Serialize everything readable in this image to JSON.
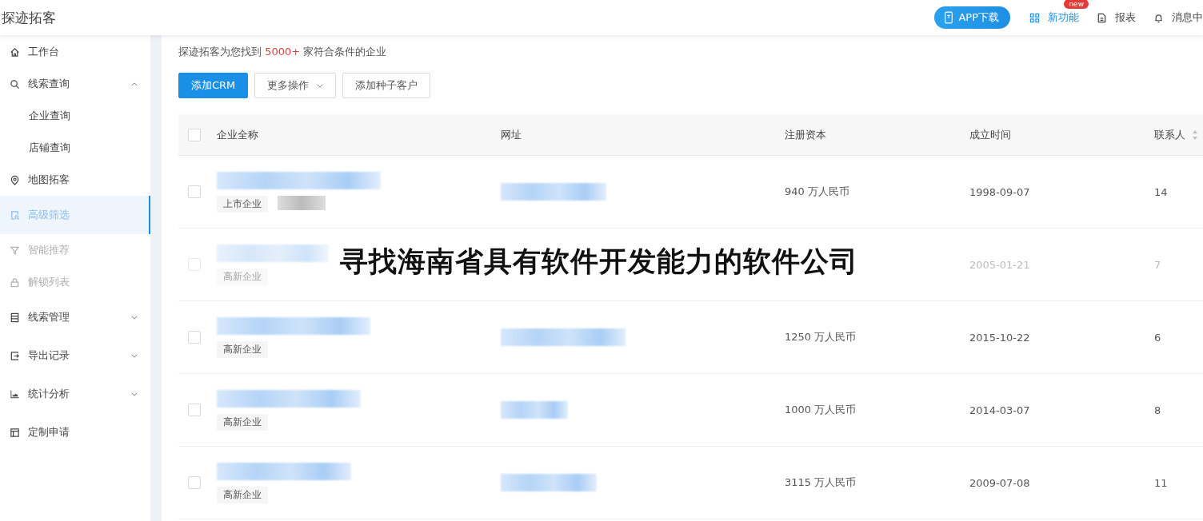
{
  "header": {
    "app_title": "探迹拓客",
    "app_download": "APP下载",
    "nav": [
      {
        "label": "新功能",
        "highlighted": true,
        "badge": "new"
      },
      {
        "label": "报表",
        "highlighted": false
      },
      {
        "label": "消息中",
        "highlighted": false
      }
    ]
  },
  "sidebar": {
    "items": [
      {
        "label": "工作台",
        "selected": false,
        "disabled": false
      },
      {
        "label": "线索查询",
        "selected": false,
        "disabled": false,
        "expanded": true,
        "children": [
          {
            "label": "企业查询",
            "selected": false
          },
          {
            "label": "店铺查询",
            "selected": false
          }
        ]
      },
      {
        "label": "地图拓客",
        "selected": false,
        "disabled": false
      },
      {
        "label": "高级筛选",
        "selected": true,
        "disabled": false
      },
      {
        "label": "智能推荐",
        "selected": false,
        "disabled": true
      },
      {
        "label": "解锁列表",
        "selected": false,
        "disabled": true
      },
      {
        "label": "线索管理",
        "selected": false,
        "disabled": false,
        "expanded": false
      },
      {
        "label": "导出记录",
        "selected": false,
        "disabled": false,
        "expanded": false
      },
      {
        "label": "统计分析",
        "selected": false,
        "disabled": false,
        "expanded": false
      },
      {
        "label": "定制申请",
        "selected": false,
        "disabled": false
      }
    ]
  },
  "summary": {
    "before": "探迹拓客为您找到",
    "count": "5000+",
    "after": "家符合条件的企业"
  },
  "toolbar": [
    {
      "label": "添加CRM",
      "kind": "primary"
    },
    {
      "label": "更多操作",
      "kind": "dropdown"
    },
    {
      "label": "添加种子客户",
      "kind": "default"
    }
  ],
  "table": {
    "select_all_checked": false,
    "columns": [
      {
        "label": "企业全称",
        "sortable": false
      },
      {
        "label": "网址",
        "sortable": false
      },
      {
        "label": "注册资本",
        "sortable": false
      },
      {
        "label": "成立时间",
        "sortable": false
      },
      {
        "label": "联系人",
        "sortable": true
      }
    ],
    "rows": [
      {
        "checked": false,
        "dimmed": false,
        "tags": [
          {
            "kind": "text",
            "label": "上市企业"
          },
          {
            "kind": "blurred"
          }
        ],
        "capital": "940 万人民币",
        "founded": "1998-09-07",
        "contacts": "14"
      },
      {
        "checked": false,
        "dimmed": true,
        "tags": [
          {
            "kind": "text",
            "label": "高新企业"
          }
        ],
        "founded": "2005-01-21",
        "contacts": "7"
      },
      {
        "checked": false,
        "dimmed": false,
        "tags": [
          {
            "kind": "text",
            "label": "高新企业"
          }
        ],
        "capital": "1250 万人民币",
        "founded": "2015-10-22",
        "contacts": "6"
      },
      {
        "checked": false,
        "dimmed": false,
        "tags": [
          {
            "kind": "text",
            "label": "高新企业"
          }
        ],
        "capital": "1000 万人民币",
        "founded": "2014-03-07",
        "contacts": "8"
      },
      {
        "checked": false,
        "dimmed": false,
        "tags": [
          {
            "kind": "text",
            "label": "高新企业"
          }
        ],
        "capital": "3115 万人民币",
        "founded": "2009-07-08",
        "contacts": "11"
      }
    ]
  },
  "caption": "寻找海南省具有软件开发能力的软件公司"
}
